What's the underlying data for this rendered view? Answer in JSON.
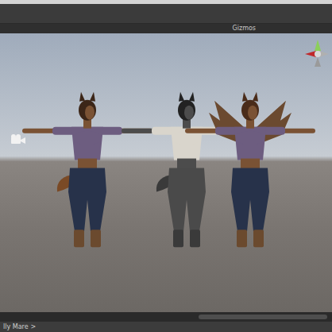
{
  "scene_view": {
    "gizmos_label": "Gizmos"
  },
  "breadcrumb": {
    "text": "lly Mare",
    "arrow": ">"
  }
}
